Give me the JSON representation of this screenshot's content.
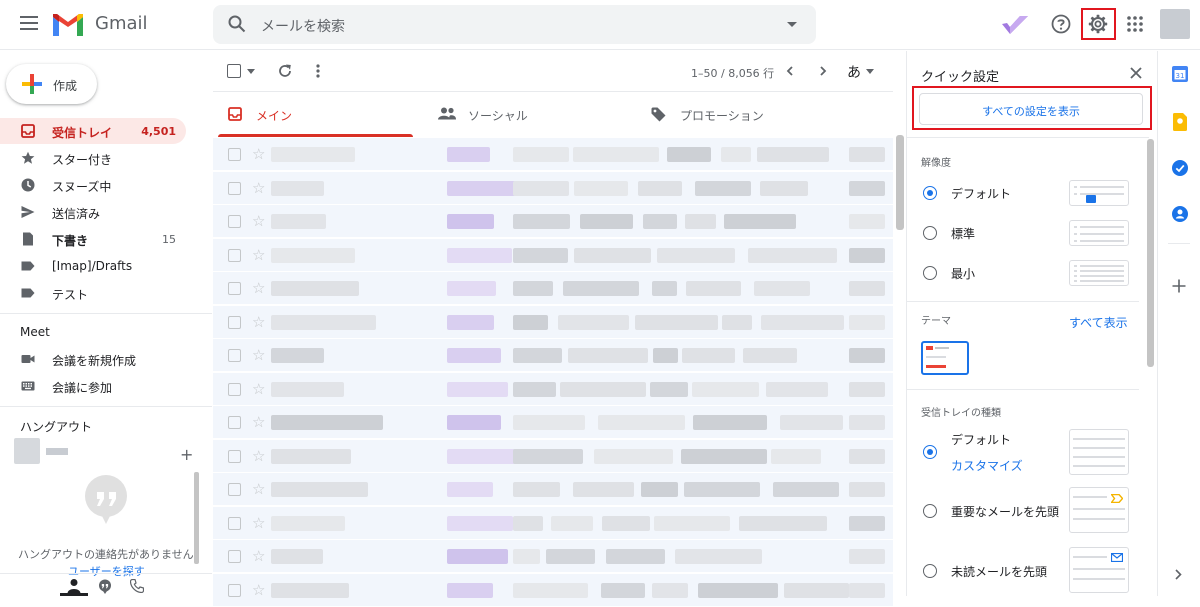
{
  "app": {
    "name": "Gmail"
  },
  "search": {
    "placeholder": "メールを検索"
  },
  "compose": {
    "label": "作成"
  },
  "nav": [
    {
      "label": "受信トレイ",
      "count": "4,501",
      "active": true
    },
    {
      "label": "スター付き",
      "count": ""
    },
    {
      "label": "スヌーズ中",
      "count": ""
    },
    {
      "label": "送信済み",
      "count": ""
    },
    {
      "label": "下書き",
      "count": "15"
    },
    {
      "label": "[Imap]/Drafts",
      "count": ""
    },
    {
      "label": "テスト",
      "count": ""
    }
  ],
  "meet": {
    "title": "Meet",
    "new_meeting": "会議を新規作成",
    "join": "会議に参加"
  },
  "hangouts": {
    "title": "ハングアウト",
    "empty": "ハングアウトの連絡先がありません",
    "find": "ユーザーを探す"
  },
  "list": {
    "count": "1–50 / 8,056 行",
    "input_tool": "あ"
  },
  "tabs": [
    {
      "label": "メイン"
    },
    {
      "label": "ソーシャル"
    },
    {
      "label": "プロモーション"
    }
  ],
  "quick_settings": {
    "title": "クイック設定",
    "all_settings": "すべての設定を表示",
    "density_title": "解像度",
    "density": [
      {
        "label": "デフォルト",
        "selected": true
      },
      {
        "label": "標準"
      },
      {
        "label": "最小"
      }
    ],
    "theme_title": "テーマ",
    "theme_link": "すべて表示",
    "inbox_title": "受信トレイの種類",
    "inbox": [
      {
        "label": "デフォルト",
        "selected": true
      },
      {
        "label": "重要なメールを先頭"
      },
      {
        "label": "未読メールを先頭"
      }
    ],
    "customize": "カスタマイズ"
  },
  "colors": {
    "gmail_red": "#d93025",
    "highlight": "#e1161f",
    "link": "#1a73e8",
    "active_bg": "#fce8e6"
  }
}
